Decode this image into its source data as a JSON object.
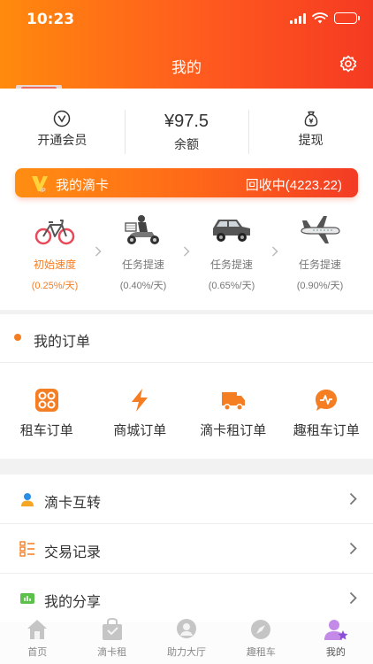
{
  "status_bar": {
    "time": "10:23"
  },
  "header": {
    "title": "我的"
  },
  "balance": {
    "membership_label": "开通会员",
    "amount": "¥97.5",
    "amount_label": "余额",
    "withdraw_label": "提现"
  },
  "card_banner": {
    "title": "我的滴卡",
    "status": "回收中(4223.22)"
  },
  "speed_levels": [
    {
      "label": "初始速度",
      "rate": "(0.25%/天)",
      "icon": "bicycle-icon",
      "active": true
    },
    {
      "label": "任务提速",
      "rate": "(0.40%/天)",
      "icon": "scooter-icon",
      "active": false
    },
    {
      "label": "任务提速",
      "rate": "(0.65%/天)",
      "icon": "car-icon",
      "active": false
    },
    {
      "label": "任务提速",
      "rate": "(0.90%/天)",
      "icon": "airplane-icon",
      "active": false
    }
  ],
  "orders": {
    "title": "我的订单",
    "items": [
      {
        "label": "租车订单",
        "icon": "grid-icon"
      },
      {
        "label": "商城订单",
        "icon": "lightning-icon"
      },
      {
        "label": "滴卡租订单",
        "icon": "truck-icon"
      },
      {
        "label": "趣租车订单",
        "icon": "pulse-chat-icon"
      }
    ]
  },
  "menu": [
    {
      "label": "滴卡互转",
      "icon": "person-icon"
    },
    {
      "label": "交易记录",
      "icon": "list-icon"
    },
    {
      "label": "我的分享",
      "icon": "share-icon"
    }
  ],
  "tabbar": [
    {
      "label": "首页",
      "icon": "home-icon",
      "active": false
    },
    {
      "label": "滴卡租",
      "icon": "bag-icon",
      "active": false
    },
    {
      "label": "助力大厅",
      "icon": "hall-icon",
      "active": false
    },
    {
      "label": "趣租车",
      "icon": "compass-icon",
      "active": false
    },
    {
      "label": "我的",
      "icon": "profile-icon",
      "active": true
    }
  ],
  "colors": {
    "accent": "#f57d22",
    "header_gradient_start": "#ff8a0d",
    "header_gradient_end": "#f53a22"
  }
}
